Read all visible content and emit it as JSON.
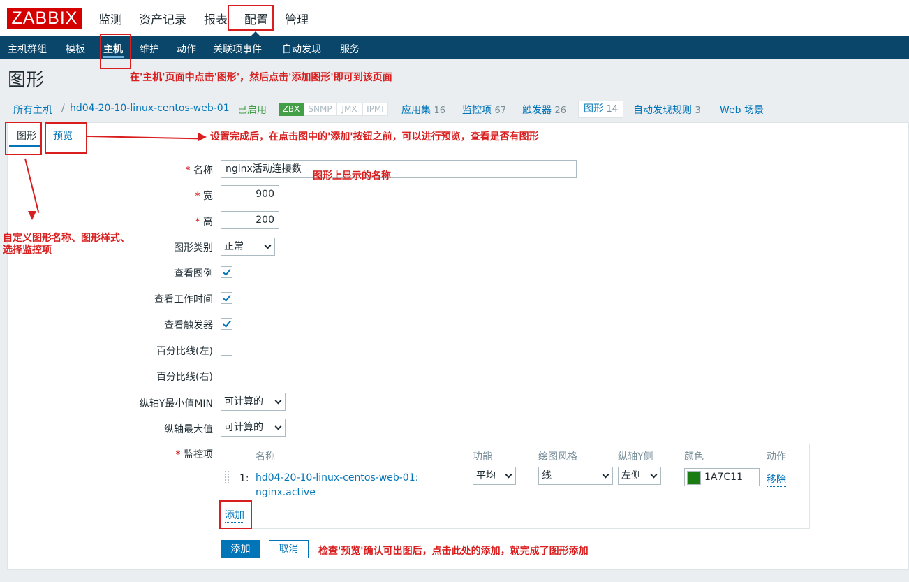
{
  "logo": "ZABBIX",
  "top_menu": [
    "监测",
    "资产记录",
    "报表",
    "配置",
    "管理"
  ],
  "sub_menu": [
    "主机群组",
    "模板",
    "主机",
    "维护",
    "动作",
    "关联项事件",
    "自动发现",
    "服务"
  ],
  "page_title": "图形",
  "breadcrumb": {
    "all_hosts": "所有主机",
    "separator": "/",
    "host": "hd04-20-10-linux-centos-web-01",
    "status": "已启用",
    "availability": [
      "ZBX",
      "SNMP",
      "JMX",
      "IPMI"
    ],
    "links": [
      {
        "label": "应用集",
        "count": "16"
      },
      {
        "label": "监控项",
        "count": "67"
      },
      {
        "label": "触发器",
        "count": "26"
      },
      {
        "label": "图形",
        "count": "14"
      },
      {
        "label": "自动发现规则",
        "count": "3"
      },
      {
        "label": "Web 场景",
        "count": ""
      }
    ]
  },
  "tabs": {
    "graph": "图形",
    "preview": "预览"
  },
  "form": {
    "name_label": "名称",
    "name_value": "nginx活动连接数",
    "width_label": "宽",
    "width_value": "900",
    "height_label": "高",
    "height_value": "200",
    "graph_type_label": "图形类别",
    "graph_type_value": "正常",
    "show_legend_label": "查看图例",
    "show_legend": true,
    "show_worktime_label": "查看工作时间",
    "show_worktime": true,
    "show_triggers_label": "查看触发器",
    "show_triggers": true,
    "percentile_left_label": "百分比线(左)",
    "percentile_left": false,
    "percentile_right_label": "百分比线(右)",
    "percentile_right": false,
    "ymin_label": "纵轴Y最小值MIN",
    "ymin_value": "可计算的",
    "ymax_label": "纵轴最大值",
    "ymax_value": "可计算的",
    "items_label": "监控项",
    "required_mark": "*"
  },
  "items_table": {
    "headers": [
      "名称",
      "功能",
      "绘图风格",
      "纵轴Y侧",
      "颜色",
      "动作"
    ],
    "rows": [
      {
        "index": "1:",
        "name_line1": "hd04-20-10-linux-centos-web-01:",
        "name_line2": "nginx.active",
        "function": "平均",
        "draw_style": "线",
        "y_side": "左侧",
        "color": "1A7C11",
        "action": "移除"
      }
    ],
    "add_link": "添加"
  },
  "buttons": {
    "add": "添加",
    "cancel": "取消"
  },
  "annotations": {
    "host_page": "在'主机'页面中点击'图形'，然后点击'添加图形'即可到该页面",
    "preview_note": "设置完成后，在点击图中的'添加'按钮之前，可以进行预览，查看是否有图形",
    "name_note": "图形上显示的名称",
    "custom_note_line1": "自定义图形名称、图形样式、",
    "custom_note_line2": "选择监控项",
    "final_note": "检查'预览'确认可出图后，点击此处的添加，就完成了图形添加"
  },
  "colors": {
    "brand": "#d40000",
    "nav": "#0a466a",
    "link": "#0275b8",
    "enabled": "#429e47",
    "item_color": "#1a7c11",
    "annotation": "#d81e1e"
  }
}
